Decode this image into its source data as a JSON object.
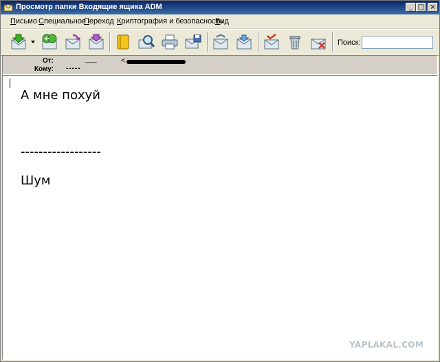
{
  "window": {
    "title": "Просмотр папки Входящие ящика ADM",
    "minimize_glyph": "_",
    "maximize_glyph": "□",
    "close_glyph": "×"
  },
  "menu": {
    "items": [
      {
        "underline": "П",
        "rest": "исьмо"
      },
      {
        "underline": "С",
        "rest": "пециальное"
      },
      {
        "underline": "П",
        "rest": "ереход"
      },
      {
        "underline": "К",
        "rest": "риптография и безопасность"
      },
      {
        "underline": "В",
        "rest": "ид"
      }
    ]
  },
  "toolbar": {
    "icons": [
      "get-mail-icon",
      "forward-back-icon",
      "reply-icon",
      "reply-all-icon",
      "address-book-icon",
      "search-mail-icon",
      "print-icon",
      "save-mail-icon",
      "move-mail-icon",
      "copy-mail-icon",
      "mark-icon",
      "delete-icon",
      "junk-icon"
    ],
    "search_label": "Поиск:",
    "search_value": ""
  },
  "header": {
    "from_label": "От:",
    "from_value": "___",
    "from_email_prefix": "<",
    "to_label": "Кому:",
    "to_value": "-----"
  },
  "message": {
    "line1": "А мне похуй",
    "separator": "------------------",
    "signature": "Шум"
  },
  "watermark": "YAPLAKAL.COM"
}
